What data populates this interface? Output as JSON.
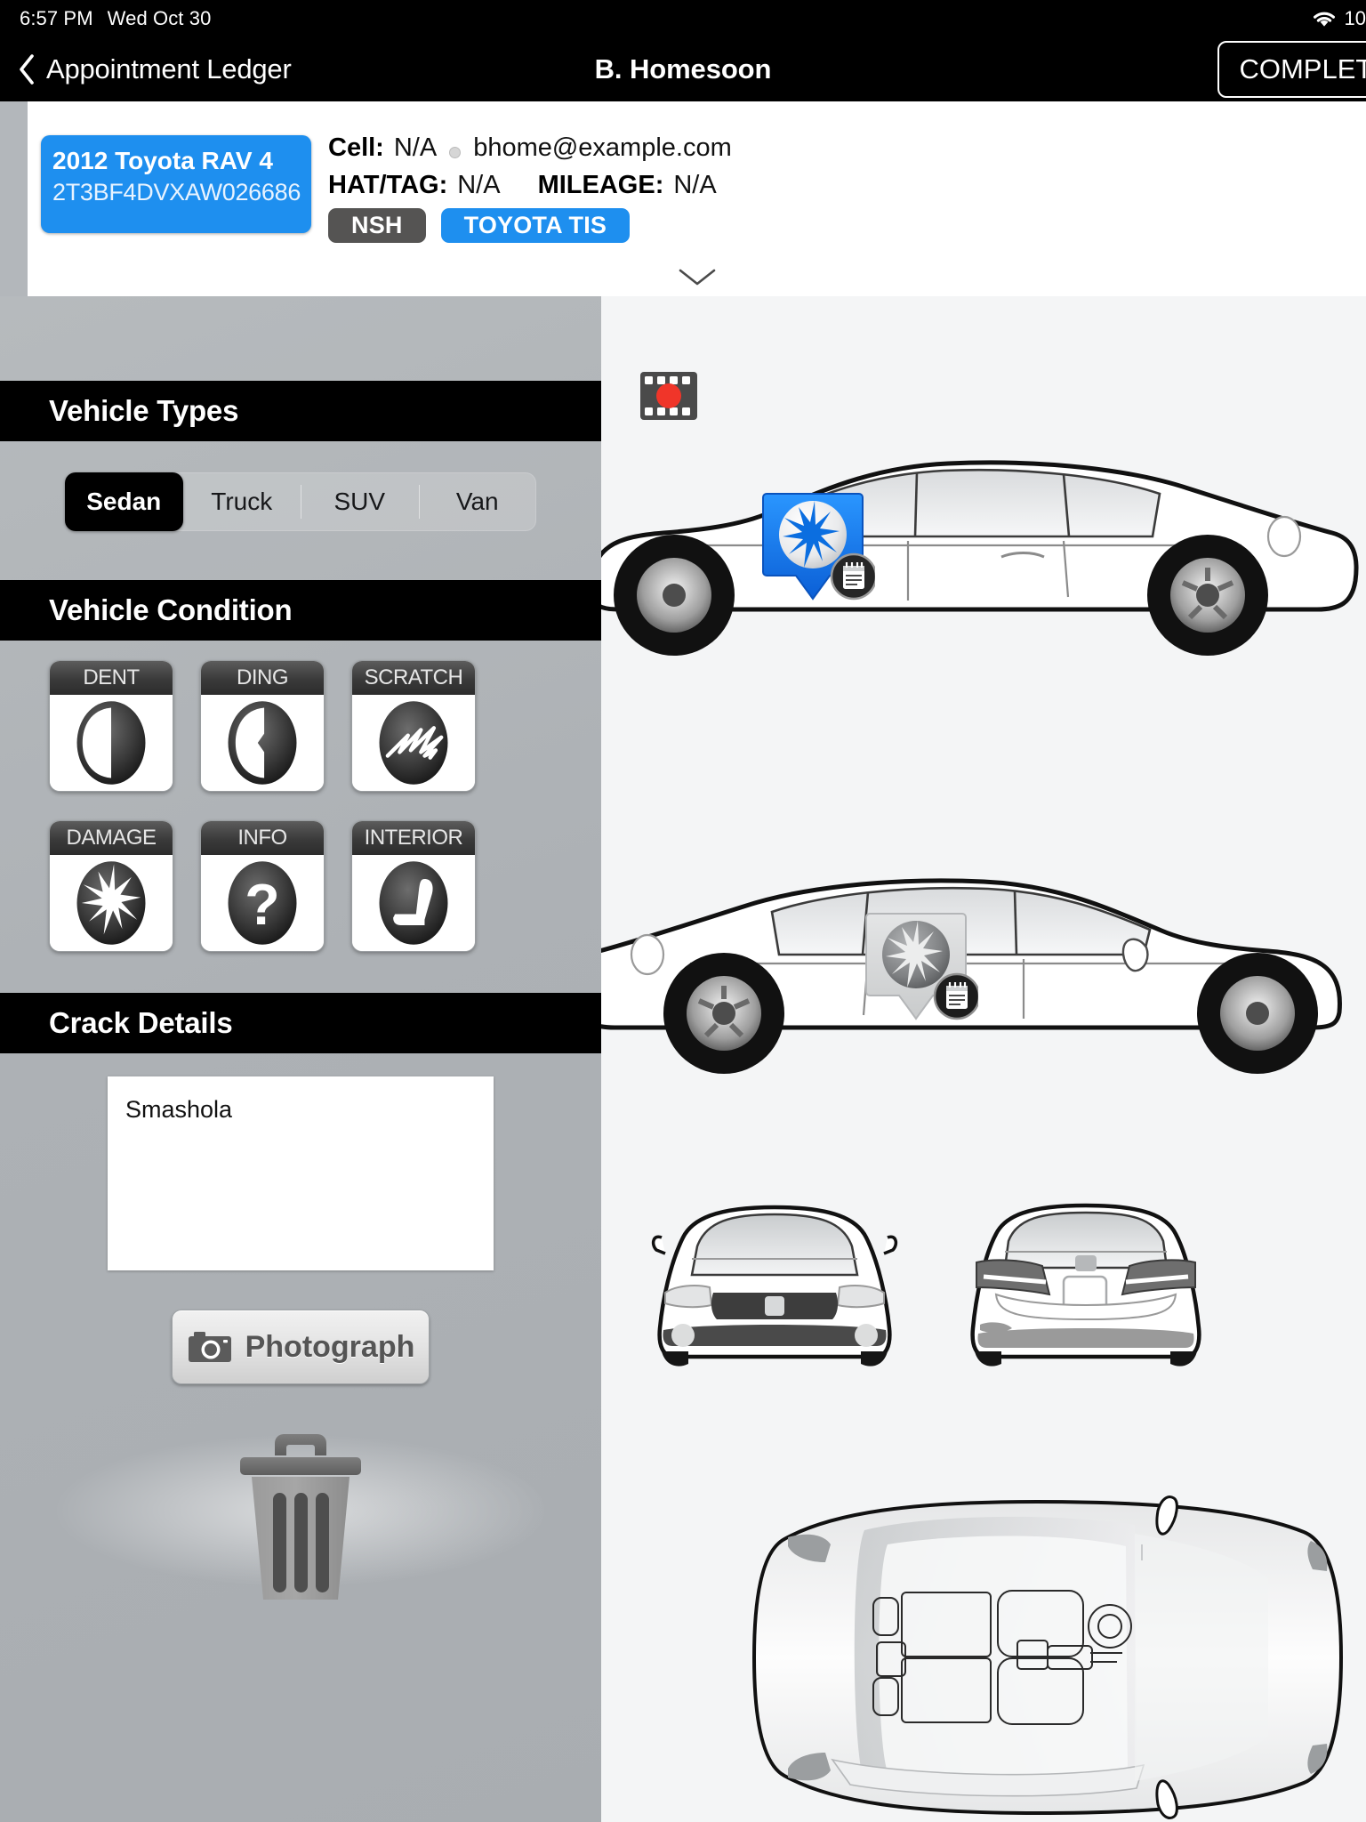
{
  "statusbar": {
    "time": "6:57 PM",
    "date": "Wed Oct 30",
    "wifi_icon": "wifi-icon",
    "battery": "10"
  },
  "navbar": {
    "back_label": "Appointment Ledger",
    "back_icon": "chevron-left-icon",
    "title": "B. Homesoon",
    "complete_label": "COMPLETE"
  },
  "vehicle_card": {
    "vehicle": "2012 Toyota RAV 4",
    "vin": "2T3BF4DVXAW026686",
    "cell_label": "Cell:",
    "cell_value": "N/A",
    "email": "bhome@example.com",
    "hattag_label": "HAT/TAG:",
    "hattag_value": "N/A",
    "mileage_label": "MILEAGE:",
    "mileage_value": "N/A",
    "badges": [
      {
        "label": "NSH",
        "color": "#555453"
      },
      {
        "label": "TOYOTA TIS",
        "color": "#1e8fef"
      }
    ],
    "collapse_icon": "chevron-down-icon"
  },
  "vehicle_types": {
    "header": "Vehicle Types",
    "options": [
      "Sedan",
      "Truck",
      "SUV",
      "Van"
    ],
    "selected": "Sedan"
  },
  "vehicle_condition": {
    "header": "Vehicle Condition",
    "tiles": [
      {
        "label": "DENT",
        "icon": "dent-icon"
      },
      {
        "label": "DING",
        "icon": "ding-icon"
      },
      {
        "label": "SCRATCH",
        "icon": "scratch-icon"
      },
      {
        "label": "DAMAGE",
        "icon": "damage-icon"
      },
      {
        "label": "INFO",
        "icon": "info-question-icon"
      },
      {
        "label": "INTERIOR",
        "icon": "car-seat-icon"
      }
    ]
  },
  "crack_details": {
    "header": "Crack Details",
    "note_value": "Smashola",
    "note_placeholder": ""
  },
  "actions": {
    "photograph_label": "Photograph",
    "photograph_icon": "camera-icon",
    "delete_icon": "trash-icon"
  },
  "diagram": {
    "record_icon": "film-record-icon",
    "views": [
      {
        "name": "driver-side-view"
      },
      {
        "name": "passenger-side-view"
      },
      {
        "name": "front-view"
      },
      {
        "name": "rear-view"
      },
      {
        "name": "top-down-view"
      }
    ],
    "markers": [
      {
        "name": "damage-marker-blue",
        "type": "damage",
        "color": "#1e7ef0",
        "has_note": true,
        "selected": true
      },
      {
        "name": "damage-marker-gray",
        "type": "damage",
        "color": "#9a9a9a",
        "has_note": true,
        "selected": false
      }
    ]
  },
  "colors": {
    "accent": "#1e8fef",
    "panel_bg": "#b3b7bb",
    "diagram_bg": "#f4f5f6",
    "header_bg": "#000000",
    "record_dot": "#f03529"
  }
}
